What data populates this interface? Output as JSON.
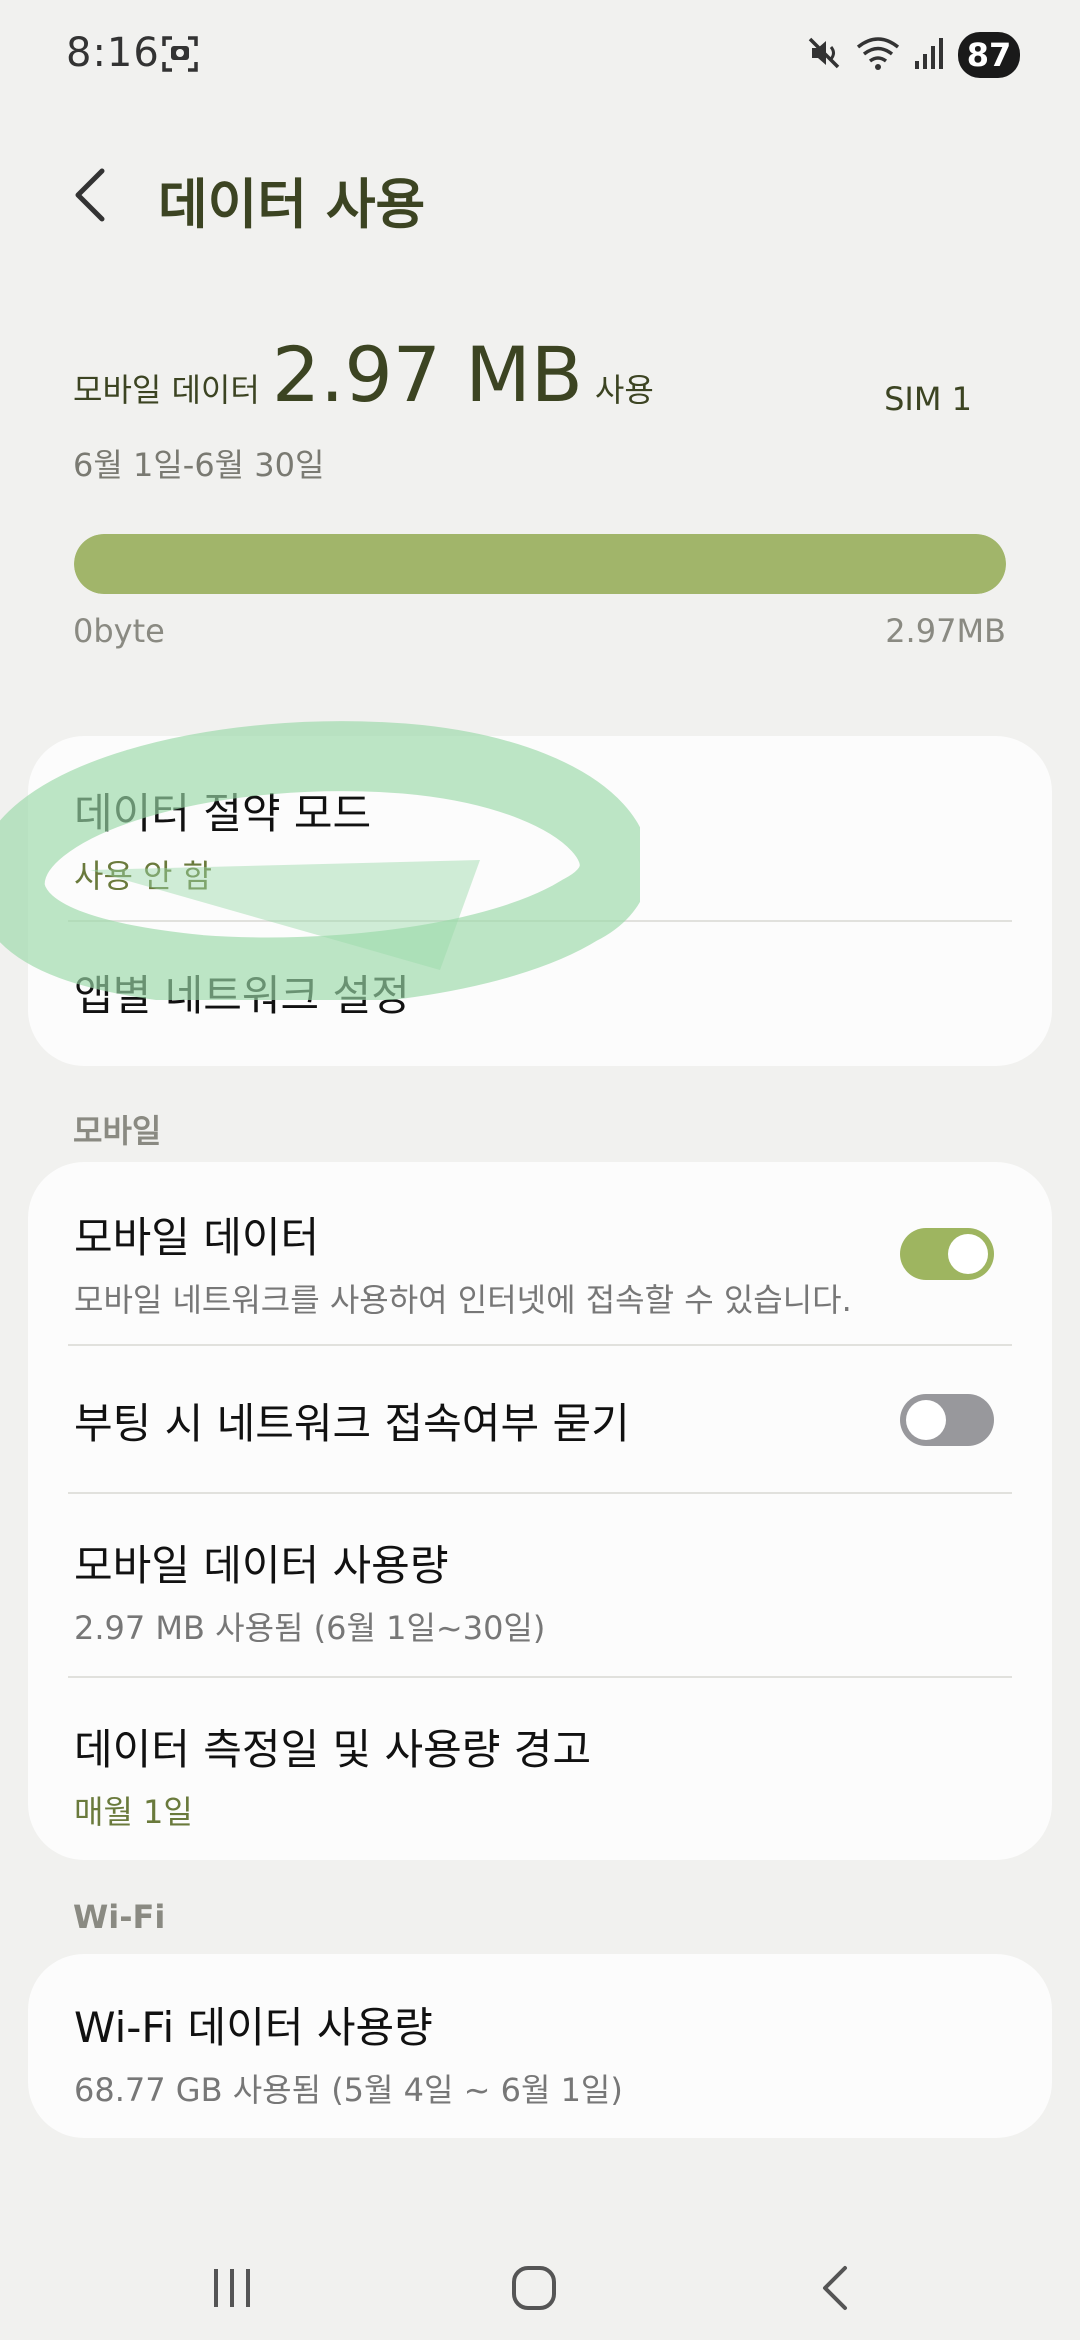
{
  "status": {
    "time": "8:16",
    "battery": "87"
  },
  "header": {
    "title": "데이터 사용"
  },
  "summary": {
    "label": "모바일 데이터",
    "value": "2.97 MB",
    "suffix": "사용",
    "sim": "SIM 1",
    "period": "6월 1일-6월 30일",
    "bar_min": "0byte",
    "bar_max": "2.97MB",
    "usage_fraction": 1.0,
    "accent": "#a1b56a"
  },
  "card1": {
    "saver_title": "데이터 절약 모드",
    "saver_status": "사용 안 함",
    "app_network_title": "앱별 네트워크 설정"
  },
  "mobile_section": {
    "header": "모바일",
    "mobile_data_title": "모바일 데이터",
    "mobile_data_desc": "모바일 네트워크를 사용하여 인터넷에 접속할 수 있습니다.",
    "mobile_data_on": true,
    "boot_ask_title": "부팅 시 네트워크 접속여부 묻기",
    "boot_ask_on": false,
    "usage_title": "모바일 데이터 사용량",
    "usage_desc": "2.97 MB 사용됨 (6월 1일~30일)",
    "cycle_title": "데이터 측정일 및 사용량 경고",
    "cycle_desc": "매월 1일"
  },
  "wifi_section": {
    "header": "Wi-Fi",
    "usage_title": "Wi-Fi 데이터 사용량",
    "usage_desc": "68.77 GB 사용됨 (5월 4일 ~ 6월 1일)"
  },
  "icons": {
    "status_left": "screenshot-icon",
    "mute": "mute-icon",
    "wifi": "wifi-icon",
    "signal": "signal-icon",
    "back": "back-arrow-icon",
    "nav_recents": "recents-icon",
    "nav_home": "home-icon",
    "nav_back": "nav-back-icon"
  }
}
